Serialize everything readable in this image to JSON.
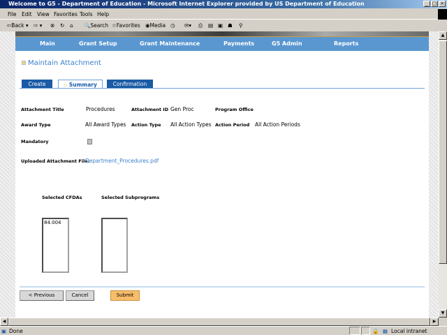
{
  "window": {
    "title": "Welcome to G5 - Department of Education - Microsoft Internet Explorer provided by US Department of Education"
  },
  "menu": [
    "File",
    "Edit",
    "View",
    "Favorites",
    "Tools",
    "Help"
  ],
  "toolbar": {
    "back": "Back",
    "search": "Search",
    "favorites": "Favorites",
    "media": "Media"
  },
  "nav": [
    "Main",
    "Grant Setup",
    "Grant Maintenance",
    "Payments",
    "G5 Admin",
    "Reports"
  ],
  "page": {
    "heading": "Maintain Attachment"
  },
  "tabs": [
    {
      "label": "Create"
    },
    {
      "label": "Summary",
      "active": true
    },
    {
      "label": "Confirmation"
    }
  ],
  "fields": {
    "attachment_title_label": "Attachment Title",
    "attachment_title": "Procedures",
    "attachment_id_label": "Attachment ID",
    "attachment_id": "Gen Proc",
    "program_office_label": "Program Office",
    "award_type_label": "Award Type",
    "award_type": "All Award Types",
    "action_type_label": "Action Type",
    "action_type": "All Action Types",
    "action_period_label": "Action Period",
    "action_period": "All Action Periods",
    "mandatory_label": "Mandatory",
    "mandatory_checked": false,
    "uploaded_label": "Uploaded Attachment File:",
    "uploaded_file": "Department_Procedures.pdf"
  },
  "lists": {
    "cfda_label": "Selected CFDAs",
    "cfda_items": [
      "84.004"
    ],
    "subprograms_label": "Selected Subprograms",
    "subprograms_items": []
  },
  "buttons": {
    "previous": "< Previous",
    "cancel": "Cancel",
    "submit": "Submit"
  },
  "status": {
    "text": "Done",
    "zone": "Local intranet"
  },
  "colors": {
    "nav": "#5a97d1",
    "tab": "#1b5aa5",
    "heading": "#3b7fcc",
    "submit": "#f8bd6a"
  }
}
